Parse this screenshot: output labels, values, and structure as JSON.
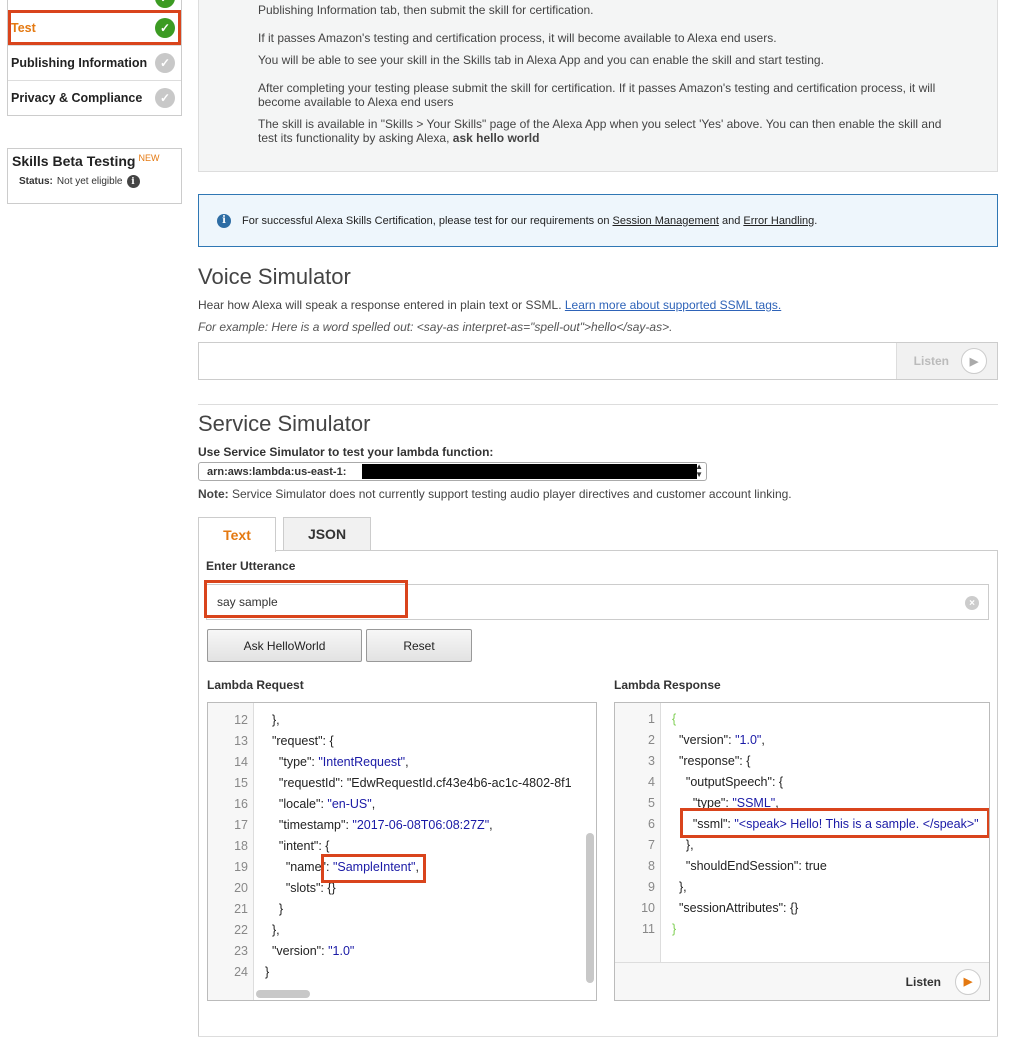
{
  "sidebar": {
    "items": [
      {
        "label": "Test",
        "status": "complete"
      },
      {
        "label": "Publishing Information",
        "status": "incomplete"
      },
      {
        "label": "Privacy & Compliance",
        "status": "incomplete"
      }
    ],
    "beta": {
      "title": "Skills Beta Testing",
      "badge": "NEW",
      "status_label": "Status:",
      "status_value": "Not yet eligible"
    }
  },
  "info_panel": {
    "p1": "Publishing Information tab, then submit the skill for certification.",
    "p2": "If it passes Amazon's testing and certification process, it will become available to Alexa end users.",
    "p3": "You will be able to see your skill in the Skills tab in Alexa App and you can enable the skill and start testing.",
    "p4": "After completing your testing please submit the skill for certification. If it passes Amazon's testing and certification process, it will become available to Alexa end users",
    "p5a": "The skill is available in \"Skills > Your Skills\" page of the Alexa App when you select 'Yes' above. You can then enable the skill and test its functionality by asking Alexa, ",
    "p5b": "ask hello world"
  },
  "notice": {
    "text_a": "For successful Alexa Skills Certification, please test for our requirements on ",
    "link1": "Session Management",
    "text_b": " and ",
    "link2": "Error Handling",
    "text_c": "."
  },
  "voice_simulator": {
    "title": "Voice Simulator",
    "desc": "Hear how Alexa will speak a response entered in plain text or SSML. ",
    "desc_link": "Learn more about supported SSML tags.",
    "example": "For example: Here is a word spelled out: <say-as interpret-as=\"spell-out\">hello</say-as>.",
    "input_value": "",
    "listen_label": "Listen"
  },
  "service_simulator": {
    "title": "Service Simulator",
    "subtitle": "Use Service Simulator to test your lambda function:",
    "arn_value": "arn:aws:lambda:us-east-1:",
    "note_label": "Note:",
    "note_text": " Service Simulator does not currently support testing audio player directives and customer account linking.",
    "tabs": [
      {
        "label": "Text",
        "active": true
      },
      {
        "label": "JSON",
        "active": false
      }
    ],
    "utterance_label": "Enter Utterance",
    "utterance_value": "say sample",
    "ask_button": "Ask HelloWorld",
    "reset_button": "Reset",
    "request_label": "Lambda Request",
    "response_label": "Lambda Response",
    "listen_label": "Listen"
  },
  "lambda_request_lines": [
    {
      "n": "12",
      "code": "  },"
    },
    {
      "n": "13",
      "code": "  \"request\": {"
    },
    {
      "n": "14",
      "code": "    \"type\": \"IntentRequest\","
    },
    {
      "n": "15",
      "code": "    \"requestId\": \"EdwRequestId.cf43e4b6-ac1c-4802-8f1"
    },
    {
      "n": "16",
      "code": "    \"locale\": \"en-US\","
    },
    {
      "n": "17",
      "code": "    \"timestamp\": \"2017-06-08T06:08:27Z\","
    },
    {
      "n": "18",
      "code": "    \"intent\": {"
    },
    {
      "n": "19",
      "code": "      \"name\": \"SampleIntent\","
    },
    {
      "n": "20",
      "code": "      \"slots\": {}"
    },
    {
      "n": "21",
      "code": "    }"
    },
    {
      "n": "22",
      "code": "  },"
    },
    {
      "n": "23",
      "code": "  \"version\": \"1.0\""
    },
    {
      "n": "24",
      "code": "}"
    }
  ],
  "lambda_response_lines": [
    {
      "n": "1",
      "code": "{"
    },
    {
      "n": "2",
      "code": "  \"version\": \"1.0\","
    },
    {
      "n": "3",
      "code": "  \"response\": {"
    },
    {
      "n": "4",
      "code": "    \"outputSpeech\": {"
    },
    {
      "n": "5",
      "code": "      \"type\": \"SSML\","
    },
    {
      "n": "6",
      "code": "      \"ssml\": \"<speak> Hello! This is a sample. </speak>\""
    },
    {
      "n": "7",
      "code": "    },"
    },
    {
      "n": "8",
      "code": "    \"shouldEndSession\": true"
    },
    {
      "n": "9",
      "code": "  },"
    },
    {
      "n": "10",
      "code": "  \"sessionAttributes\": {}"
    },
    {
      "n": "11",
      "code": "}"
    }
  ],
  "colors": {
    "accent": "#e47911",
    "highlight": "#d9441c",
    "success": "#3c9b23",
    "json_string": "#1a1aa6"
  }
}
